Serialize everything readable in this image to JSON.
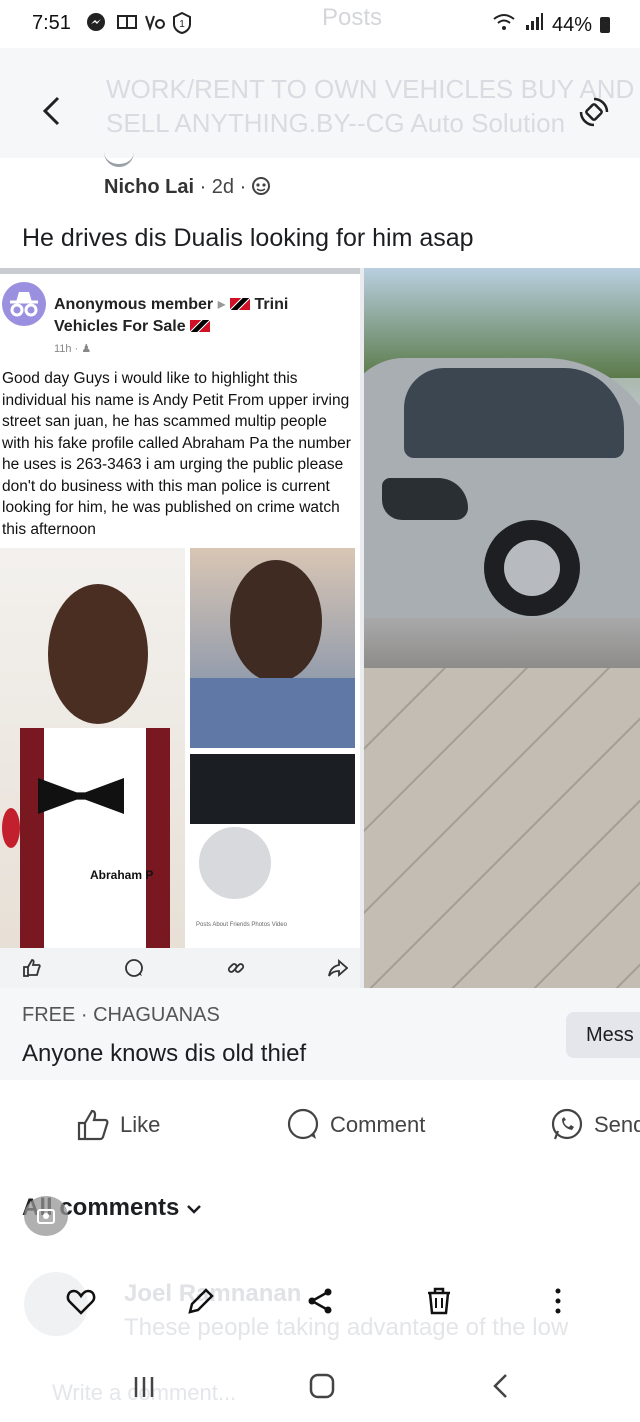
{
  "status": {
    "time": "7:51",
    "ghost": "Posts",
    "battery": "44%"
  },
  "header": {
    "ghost_title": "WORK/RENT TO OWN VEHICLES BUY AND SELL ANYTHING.BY--CG Auto Solution"
  },
  "post": {
    "author": "Nicho Lai",
    "meta": " · 2d · ",
    "caption": "He drives dis Dualis looking for him asap"
  },
  "screenshot": {
    "name": "Anonymous member",
    "group_prefix": "Trini",
    "group": "Vehicles For Sale",
    "time": "11h · ",
    "body": "Good day Guys i would like to highlight this individual his name is Andy Petit From upper irving street san juan, he has scammed multip people with his fake profile called Abraham Pa the number he uses is 263-3463 i am urging the public please don't do business with this man police is current looking for him, he was published on crime watch this afternoon",
    "profile_name": "Abraham P",
    "mini_tabs": "Posts   About   Friends   Photos   Video"
  },
  "listing": {
    "tag": "FREE · CHAGUANAS",
    "title": "Anyone knows dis old thief",
    "message_button": "Mess"
  },
  "actions": {
    "like": "Like",
    "comment": "Comment",
    "send": "Send"
  },
  "comments": {
    "all_label": "All comments",
    "ghost_name": "Joel Ramnanan",
    "ghost_text": "These people taking advantage of the low",
    "ghost_write": "Write a comment..."
  },
  "colors": {
    "accent": "#1877f2",
    "background": "#ffffff",
    "panel": "#f6f7f9"
  }
}
